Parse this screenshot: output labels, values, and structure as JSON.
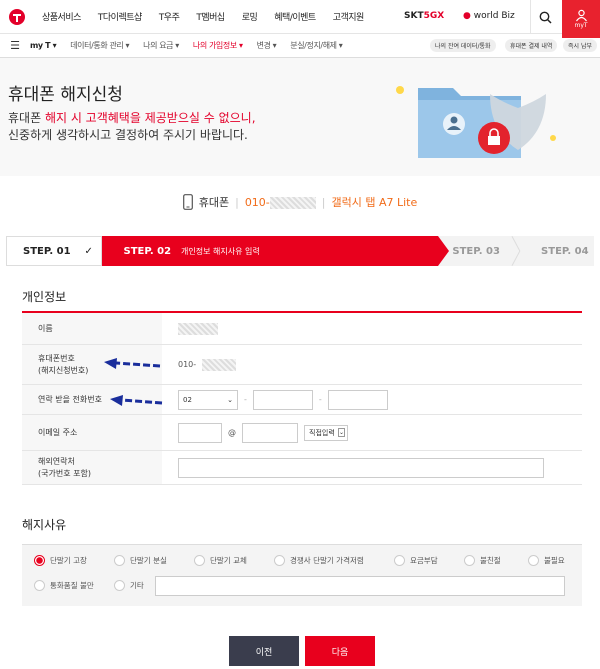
{
  "gnb": [
    "상품서비스",
    "T다이렉트샵",
    "T우주",
    "T멤버십",
    "로밍",
    "혜택/이벤트",
    "고객지원"
  ],
  "brand": {
    "skt": "SKT",
    "fiveg": "5GX",
    "worldbiz": "world Biz",
    "myt": "myT"
  },
  "subnav": {
    "menu_label": "my T",
    "items": [
      "데이터/통화 관리",
      "나의 요금",
      "나의 가입정보",
      "변경",
      "분실/정지/해제"
    ],
    "quick": [
      "나의 잔여 데이터/통화",
      "휴대폰 결제 내역",
      "즉시 납부"
    ]
  },
  "hero": {
    "title": "휴대폰 해지신청",
    "line1_prefix": "휴대폰 ",
    "line1_red": "해지 시 고객혜택을 제공받으실 수 없으니,",
    "line2": "신중하게 생각하시고 결정하여 주시기 바랍니다."
  },
  "device": {
    "type": "휴대폰",
    "number_prefix": "010-",
    "model": "갤럭시 탭 A7 Lite"
  },
  "steps": {
    "s1": "STEP. 01",
    "s2": "STEP. 02",
    "s2_desc": "개인정보 해지사유 입력",
    "s3": "STEP. 03",
    "s4": "STEP. 04"
  },
  "personal": {
    "title": "개인정보",
    "name_label": "이름",
    "phone_label": "휴대폰번호\n(해지신청번호)",
    "phone_value": "010-",
    "contact_label": "연락 받을 전화번호",
    "contact_area": "02",
    "email_label": "이메일 주소",
    "email_at": "@",
    "email_domain": "직접입력",
    "overseas_label": "해외연락처\n(국가번호 포함)"
  },
  "reason": {
    "title": "해지사유",
    "options": [
      "단말기 고장",
      "단말기 분실",
      "단말기 교체",
      "경쟁사 단말기 가격저렴",
      "요금부담",
      "불친절",
      "불필요",
      "통화품질 불만",
      "기타"
    ],
    "selected": 0
  },
  "buttons": {
    "prev": "이전",
    "next": "다음"
  },
  "colors": {
    "accent": "#e8001d",
    "prev_btn": "#3a3d4d",
    "orange": "#f16c1a"
  }
}
